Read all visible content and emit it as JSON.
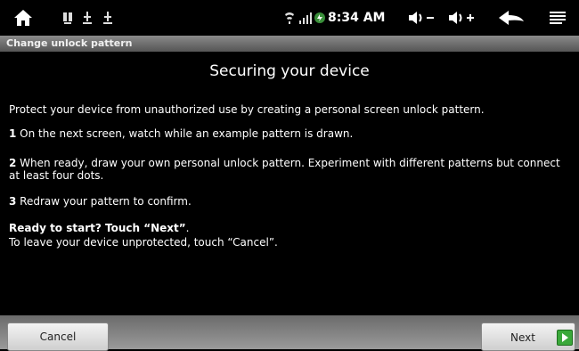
{
  "status_bar": {
    "time": "8:34 AM",
    "icons": [
      "home-icon",
      "usb-debug-icon",
      "usb-icon",
      "usb-icon",
      "wifi-icon",
      "signal-icon",
      "battery-charging-icon",
      "volume-down-icon",
      "volume-up-icon",
      "back-icon",
      "menu-icon"
    ]
  },
  "title_bar": {
    "title": "Change unlock pattern"
  },
  "main": {
    "heading": "Securing your device",
    "intro": "Protect your device from unauthorized use by creating a personal screen unlock pattern.",
    "steps": [
      {
        "num": "1",
        "text": " On the next screen, watch while an example pattern is drawn."
      },
      {
        "num": "2",
        "text": " When ready, draw your own personal unlock pattern. Experiment with different patterns but connect at least four dots."
      },
      {
        "num": "3",
        "text": " Redraw your pattern to confirm."
      }
    ],
    "ready": "Ready to start? Touch “Next”",
    "ready_suffix": ".",
    "leave": "To leave your device unprotected, touch “Cancel”."
  },
  "buttons": {
    "cancel": "Cancel",
    "next": "Next"
  }
}
